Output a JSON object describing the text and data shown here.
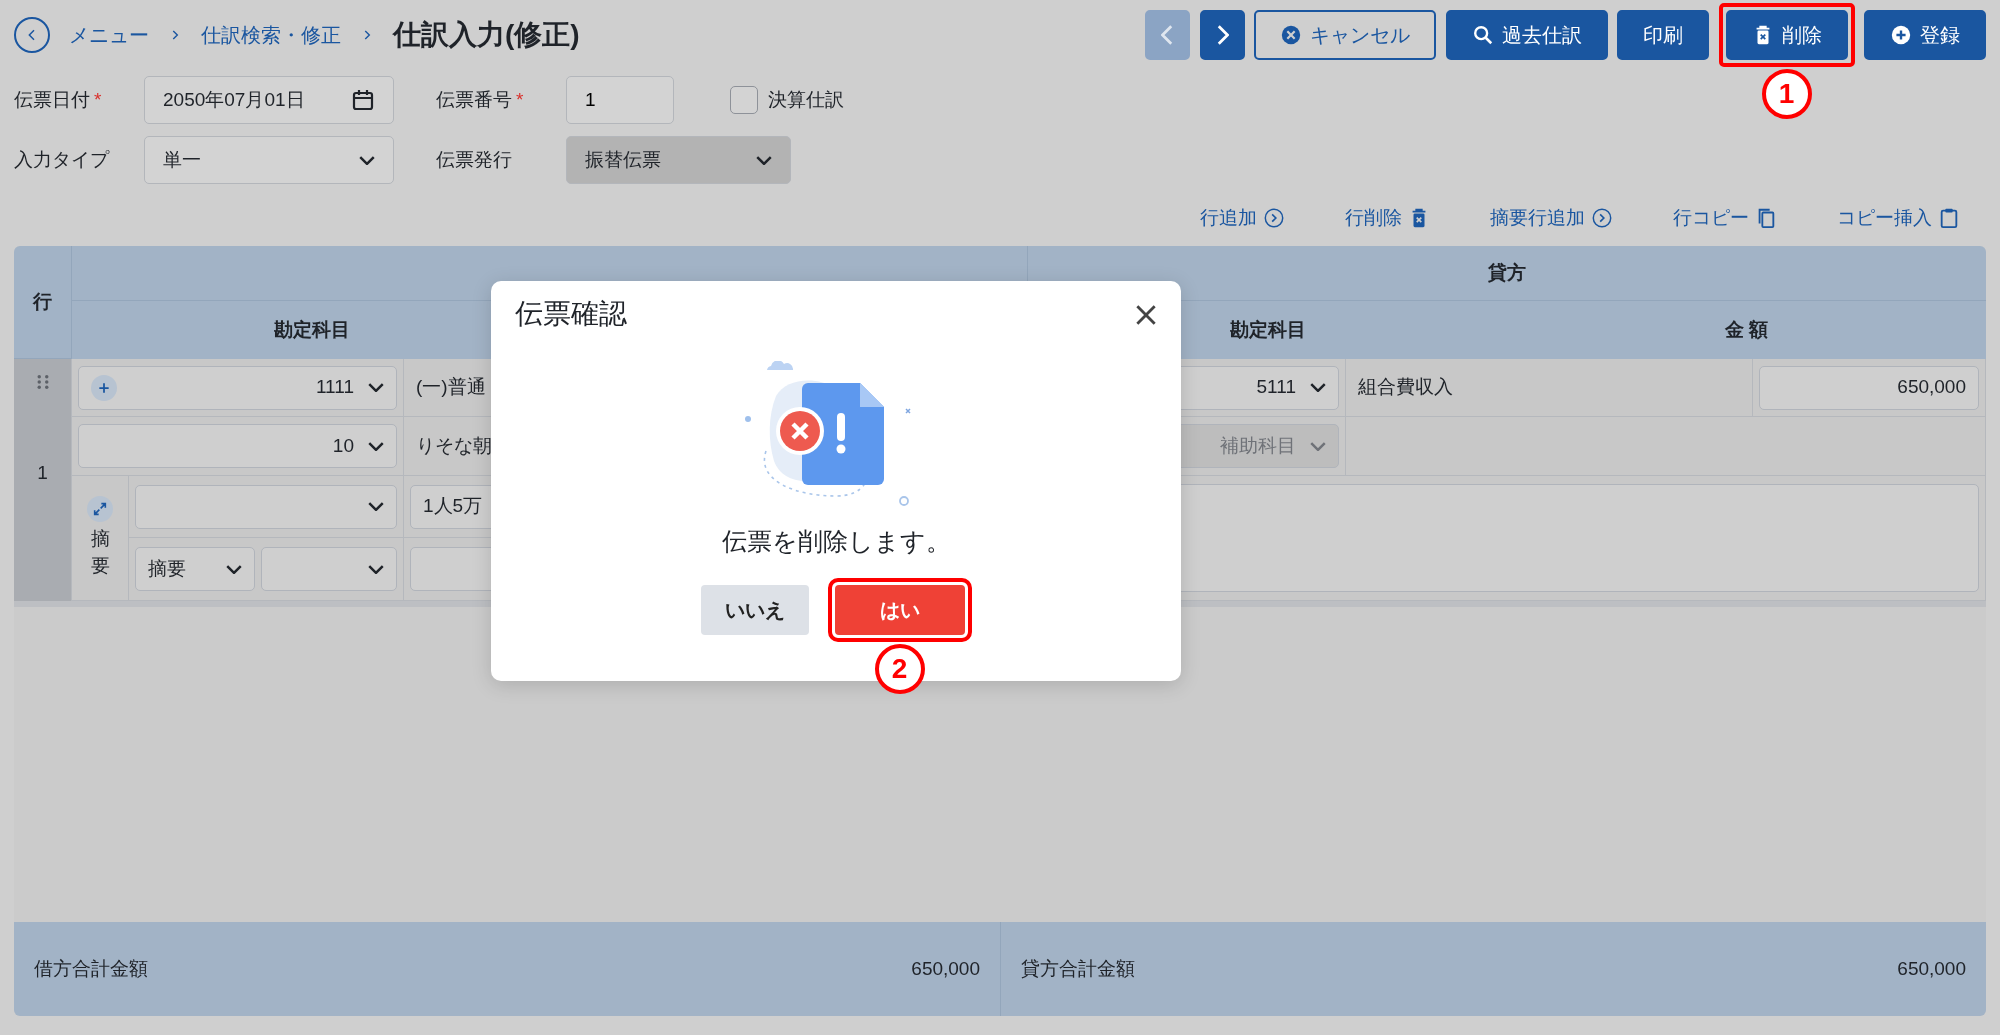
{
  "breadcrumb": {
    "items": [
      {
        "label": "メニュー"
      },
      {
        "label": "仕訳検索・修正"
      }
    ],
    "title": "仕訳入力(修正)"
  },
  "toolbar": {
    "buttons": [
      {
        "kind": "prev",
        "disabled": true,
        "highlighted": false
      },
      {
        "kind": "next",
        "disabled": false,
        "highlighted": false
      },
      {
        "kind": "cancel",
        "label": "キャンセル",
        "disabled": false,
        "highlighted": false
      },
      {
        "kind": "search",
        "label": "過去仕訳",
        "disabled": false,
        "highlighted": false
      },
      {
        "kind": "print",
        "label": "印刷",
        "disabled": false,
        "highlighted": false
      },
      {
        "kind": "delete",
        "label": "削除",
        "disabled": false,
        "highlighted": true,
        "callout": "1"
      },
      {
        "kind": "register",
        "label": "登録",
        "disabled": false,
        "highlighted": false
      }
    ]
  },
  "form": {
    "required_mark": "*",
    "rows": [
      [
        {
          "kind": "date",
          "label": "伝票日付",
          "required": true,
          "value": "2050年07月01日"
        },
        {
          "kind": "text",
          "label": "伝票番号",
          "required": true,
          "value": "1"
        },
        {
          "kind": "checkbox",
          "label": "決算仕訳",
          "checked": false
        }
      ],
      [
        {
          "kind": "select",
          "label": "入力タイプ",
          "required": false,
          "value": "単一",
          "disabled": false
        },
        {
          "kind": "select",
          "label": "伝票発行",
          "required": false,
          "value": "振替伝票",
          "disabled": true
        }
      ]
    ]
  },
  "row_actions": [
    {
      "kind": "add",
      "label": "行追加"
    },
    {
      "kind": "delete",
      "label": "行削除"
    },
    {
      "kind": "add",
      "label": "摘要行追加"
    },
    {
      "kind": "copy",
      "label": "行コピー"
    },
    {
      "kind": "paste",
      "label": "コピー挿入"
    }
  ],
  "journal_table": {
    "header": {
      "row": "行",
      "credit": "貸方",
      "debit_account": "勘定科目",
      "credit_account": "勘定科目",
      "credit_amount": "金 額"
    },
    "rows": [
      {
        "number": "1",
        "debit": {
          "account_code": "1111",
          "account_name": "(一)普通",
          "sub_code": "10",
          "sub_name": "りそな朝",
          "summary_label": "摘要",
          "summary_type": "摘要",
          "summary_text": "1人5万"
        },
        "credit": {
          "account_code": "5111",
          "account_name": "組合費収入",
          "amount": "650,000",
          "sub_placeholder": "補助科目"
        }
      }
    ]
  },
  "totals": [
    {
      "label": "借方合計金額",
      "value": "650,000"
    },
    {
      "label": "貸方合計金額",
      "value": "650,000"
    }
  ],
  "modal": {
    "title": "伝票確認",
    "message": "伝票を削除します。",
    "buttons": [
      {
        "kind": "secondary",
        "label": "いいえ",
        "highlighted": false
      },
      {
        "kind": "danger",
        "label": "はい",
        "highlighted": true,
        "callout": "2"
      }
    ]
  }
}
